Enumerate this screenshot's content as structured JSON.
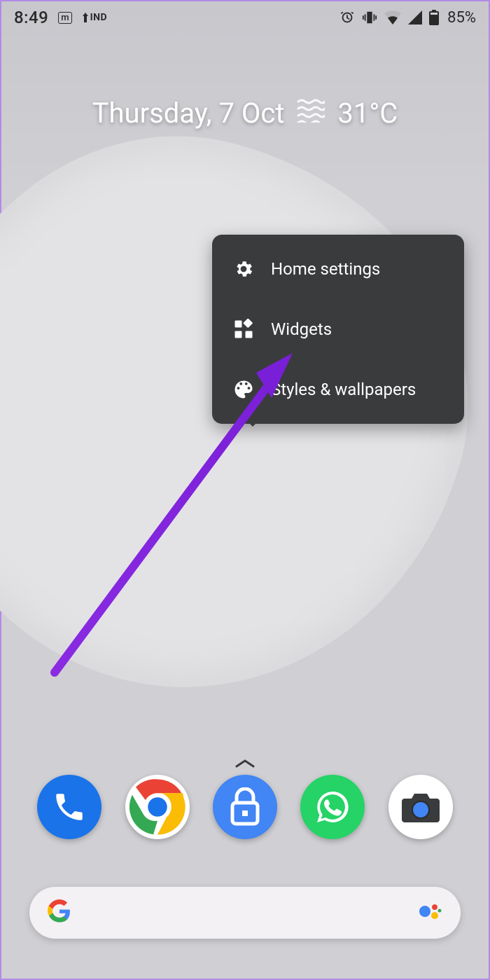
{
  "status": {
    "time": "8:49",
    "m_label": "m",
    "ind_label": "IND",
    "battery": "85%"
  },
  "widget": {
    "date": "Thursday, 7 Oct",
    "temp": "31°C"
  },
  "menu": {
    "items": [
      {
        "label": "Home settings"
      },
      {
        "label": "Widgets"
      },
      {
        "label": "Styles & wallpapers"
      }
    ]
  }
}
